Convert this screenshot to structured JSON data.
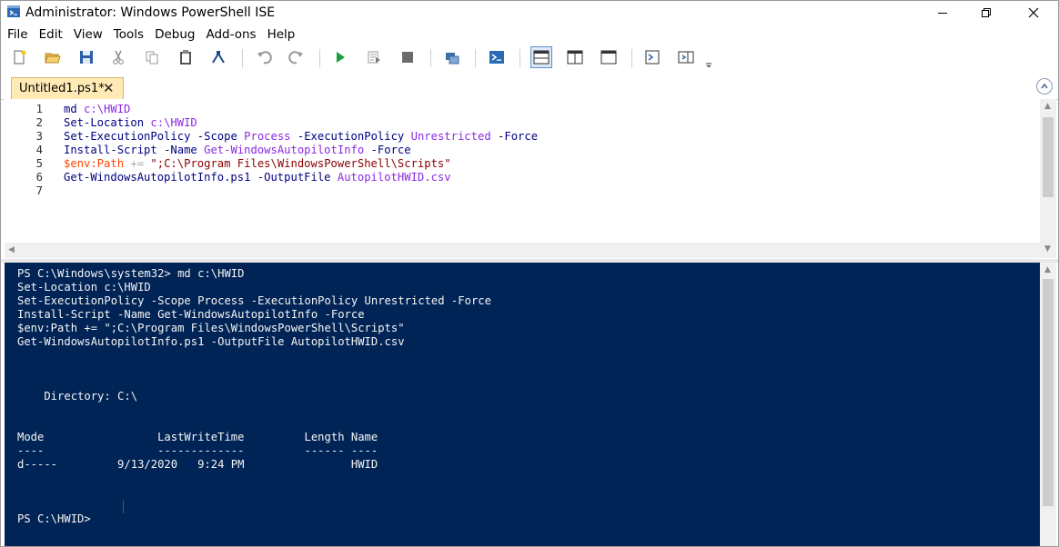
{
  "window": {
    "title": "Administrator: Windows PowerShell ISE"
  },
  "menu": [
    "File",
    "Edit",
    "View",
    "Tools",
    "Debug",
    "Add-ons",
    "Help"
  ],
  "toolbar_icons": [
    "new-icon",
    "open-icon",
    "save-icon",
    "cut-icon",
    "copy-icon",
    "paste-icon",
    "clear-icon",
    "undo-icon",
    "redo-icon",
    "run-icon",
    "run-selection-icon",
    "stop-icon",
    "remote-icon",
    "powershell-icon",
    "layout-top-icon",
    "layout-right-icon",
    "layout-max-icon",
    "show-script-icon",
    "show-commands-icon"
  ],
  "tab": {
    "label": "Untitled1.ps1*",
    "close": "✕"
  },
  "editor": {
    "line_numbers": [
      "1",
      "2",
      "3",
      "4",
      "5",
      "6",
      "7"
    ],
    "lines": [
      "md c:\\HWID",
      "Set-Location c:\\HWID",
      "Set-ExecutionPolicy -Scope Process -ExecutionPolicy Unrestricted -Force",
      "Install-Script -Name Get-WindowsAutopilotInfo -Force",
      "$env:Path += \";C:\\Program Files\\WindowsPowerShell\\Scripts\"",
      "Get-WindowsAutopilotInfo.ps1 -OutputFile AutopilotHWID.csv",
      ""
    ]
  },
  "console": {
    "lines": [
      "PS C:\\Windows\\system32> md c:\\HWID",
      "Set-Location c:\\HWID",
      "Set-ExecutionPolicy -Scope Process -ExecutionPolicy Unrestricted -Force",
      "Install-Script -Name Get-WindowsAutopilotInfo -Force",
      "$env:Path += \";C:\\Program Files\\WindowsPowerShell\\Scripts\"",
      "Get-WindowsAutopilotInfo.ps1 -OutputFile AutopilotHWID.csv",
      "",
      "",
      "",
      "    Directory: C:\\",
      "",
      "",
      "Mode                 LastWriteTime         Length Name",
      "----                 -------------         ------ ----",
      "d-----         9/13/2020   9:24 PM                HWID",
      "",
      "",
      "",
      "PS C:\\HWID>"
    ]
  },
  "colors": {
    "console_bg": "#012456",
    "keyword": "#0000ff",
    "command": "#000080",
    "param": "#000080",
    "argument": "#8a2be2",
    "variable": "#ff4500",
    "string": "#8b0000"
  }
}
